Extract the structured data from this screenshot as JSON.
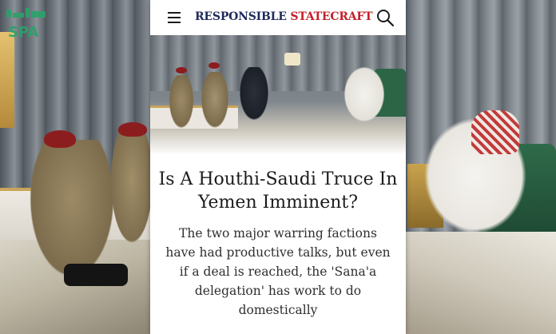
{
  "watermark": {
    "logo_text": "SPA"
  },
  "header": {
    "brand_part1": "RESPONSIBLE ",
    "brand_part2": "STATECRAFT",
    "menu_icon": "hamburger-menu-icon",
    "search_icon": "search-icon"
  },
  "article": {
    "title": "Is A Houthi-Saudi Truce In Yemen Imminent?",
    "deck": "The two major warring factions have had productive talks, but even if a deal is reached, the 'Sana'a delegation' has work to do domestically"
  },
  "colors": {
    "brand_navy": "#1e2a5a",
    "brand_red": "#c3202a",
    "watermark_green": "#1f8f5a"
  }
}
